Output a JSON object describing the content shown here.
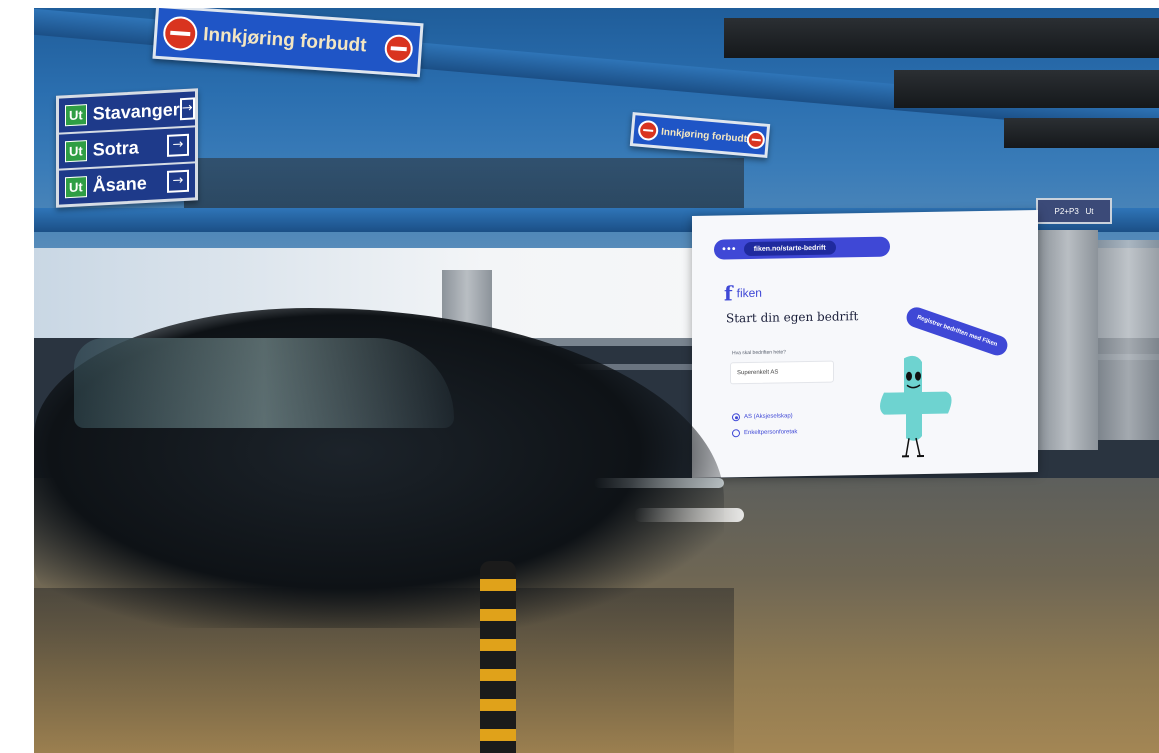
{
  "signs": {
    "main_no_entry": "Innkjøring forbudt",
    "small_no_entry": "Innkjøring forbudt",
    "far_sign": "P2+P3   Ut"
  },
  "direction_sign": {
    "badge": "Ut",
    "rows": [
      {
        "label": "Stavanger",
        "arrow": "→"
      },
      {
        "label": "Sotra",
        "arrow": "→"
      },
      {
        "label": "Åsane",
        "arrow": "→"
      }
    ]
  },
  "billboard": {
    "url": "fiken.no/starte-bedrift",
    "url_dots": "•••",
    "logo_mark": "f",
    "logo_text": "fiken",
    "title": "Start din egen bedrift",
    "question": "Hva skal bedriften hete?",
    "input_value": "Superenkelt AS",
    "radio_options": [
      {
        "label": "AS (Aksjeselskap)",
        "selected": true
      },
      {
        "label": "Enkeltpersonforetak",
        "selected": false
      }
    ],
    "cta": "Registrer bedriften med Fiken",
    "accent_color": "#3f48d6",
    "mascot_color": "#6ed3d0"
  }
}
